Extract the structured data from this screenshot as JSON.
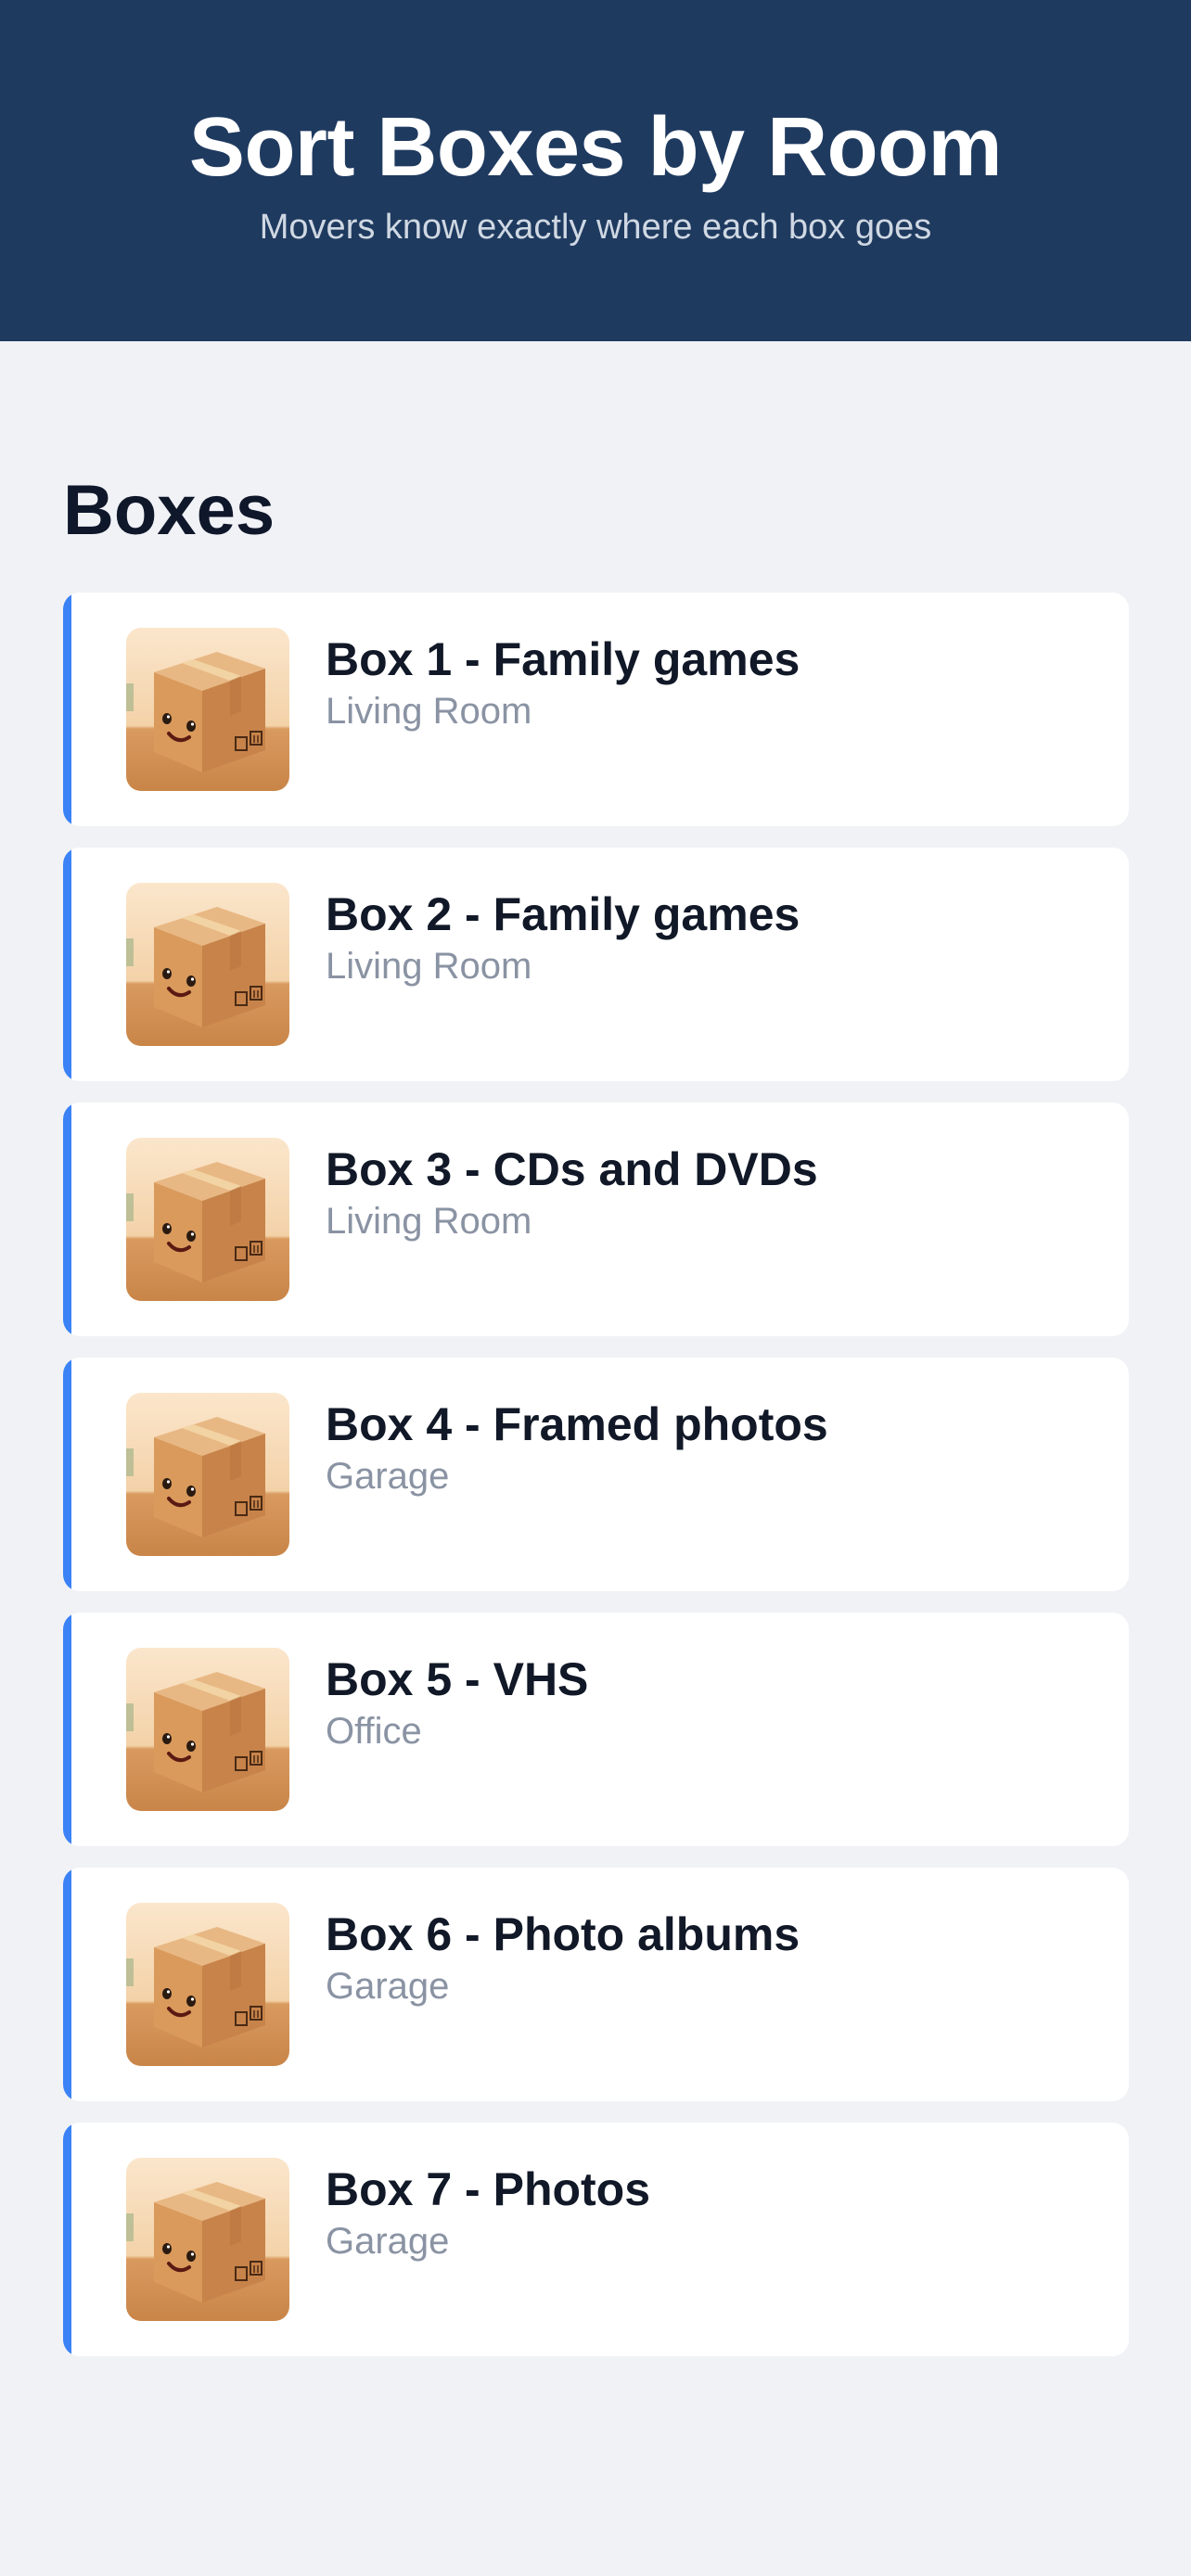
{
  "header": {
    "title": "Sort Boxes by Room",
    "subtitle": "Movers know exactly where each box goes"
  },
  "section": {
    "title": "Boxes"
  },
  "colors": {
    "header_bg": "#1f3a5f",
    "accent": "#3b82f6",
    "page_bg": "#f1f2f6"
  },
  "boxes": [
    {
      "title": "Box 1 - Family games",
      "room": "Living Room",
      "icon": "cardboard-box-icon"
    },
    {
      "title": "Box 2 - Family games",
      "room": "Living Room",
      "icon": "cardboard-box-icon"
    },
    {
      "title": "Box 3 - CDs and DVDs",
      "room": "Living Room",
      "icon": "cardboard-box-icon"
    },
    {
      "title": "Box 4 - Framed photos",
      "room": "Garage",
      "icon": "cardboard-box-icon"
    },
    {
      "title": "Box 5 - VHS",
      "room": "Office",
      "icon": "cardboard-box-icon"
    },
    {
      "title": "Box 6 - Photo albums",
      "room": "Garage",
      "icon": "cardboard-box-icon"
    },
    {
      "title": "Box 7 - Photos",
      "room": "Garage",
      "icon": "cardboard-box-icon"
    }
  ]
}
